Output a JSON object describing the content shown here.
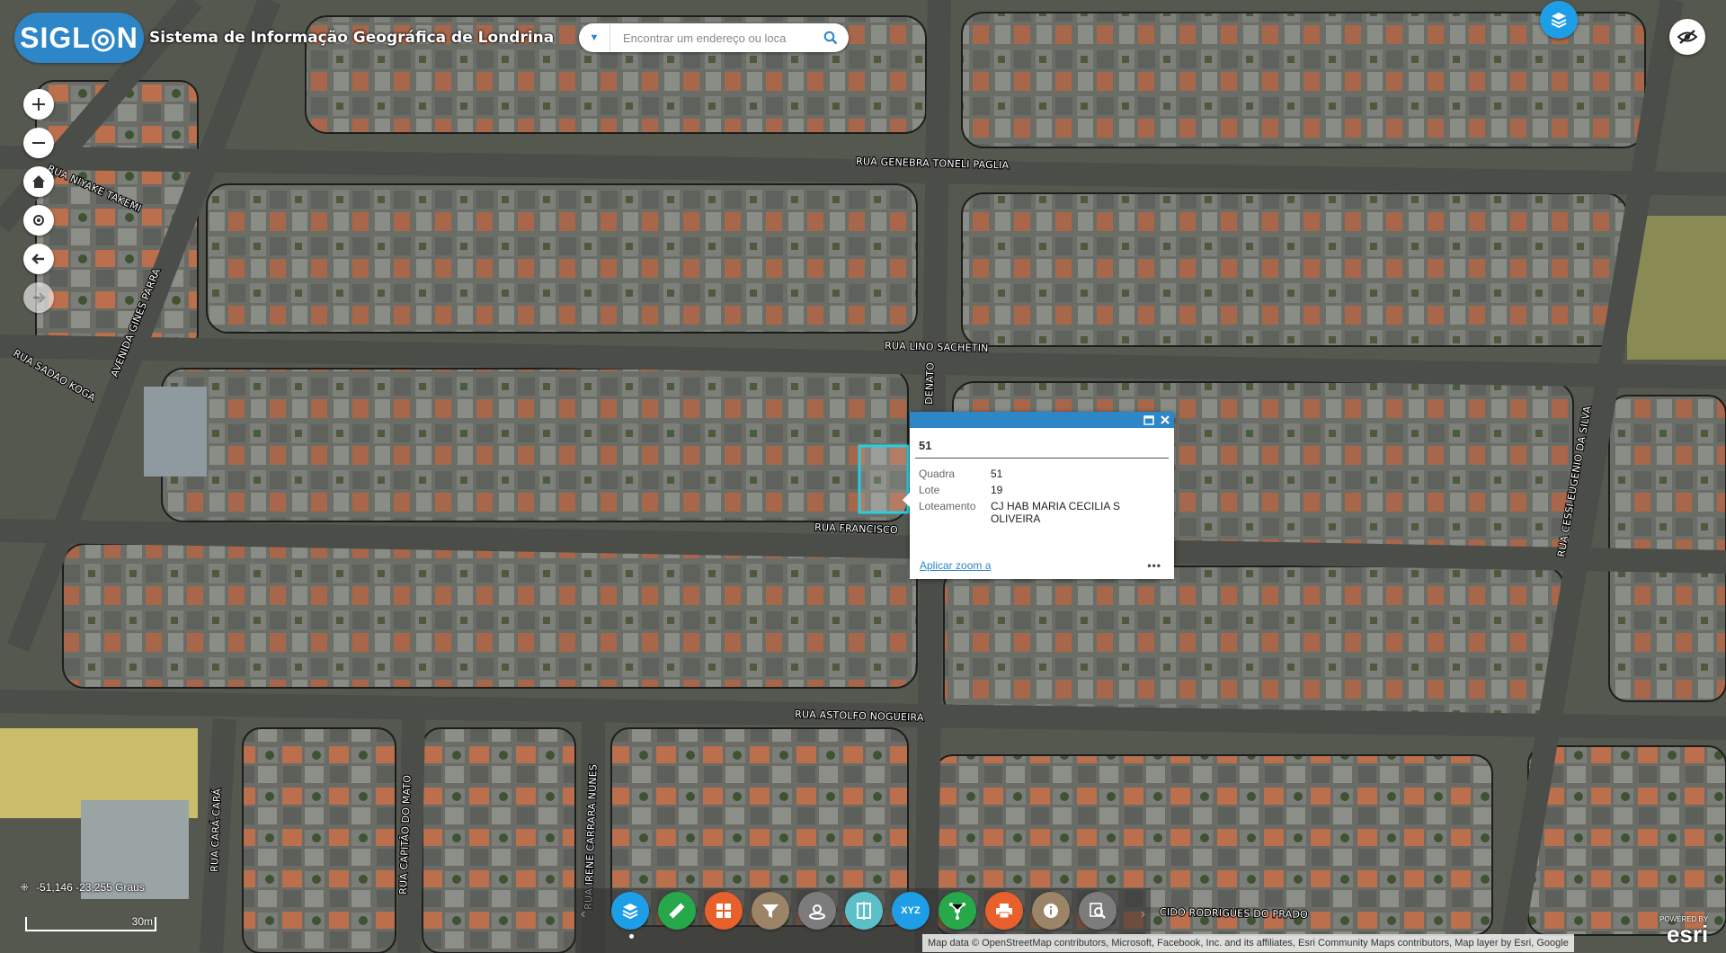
{
  "header": {
    "logo_text": "SIGL◎N",
    "title": "Sistema de Informação Geográfica de Londrina",
    "search_placeholder": "Encontrar um endereço ou loca"
  },
  "nav_icons": [
    "zoom-in-icon",
    "zoom-out-icon",
    "home-icon",
    "locate-icon",
    "back-icon",
    "forward-icon"
  ],
  "streets": [
    {
      "name": "RUA GENEBRA TONELI PAGLIA"
    },
    {
      "name": "RUA LINO SACHETIN"
    },
    {
      "name": "RUA FRANCISCO"
    },
    {
      "name": "RUA ASTOLFO NOGUEIRA"
    },
    {
      "name": "RUA NIYAKE TAKEMI"
    },
    {
      "name": "AVENIDA GINES PARRA"
    },
    {
      "name": "RUA SADAO KOGA"
    },
    {
      "name": "RUA CESSI EUGENIO DA SILVA"
    },
    {
      "name": "RUA CARÁ-CARÁ"
    },
    {
      "name": "RUA CAPITÃO DO MATO"
    },
    {
      "name": "RUA IRENE CARRARA NUNES"
    },
    {
      "name": "CIDO RODRIGUES DO PRADO"
    },
    {
      "name": "DENATO"
    }
  ],
  "popup": {
    "title": "51",
    "fields": [
      {
        "key": "Quadra",
        "value": "51"
      },
      {
        "key": "Lote",
        "value": "19"
      },
      {
        "key": "Loteamento",
        "value": "CJ HAB MARIA CECILIA S OLIVEIRA"
      }
    ],
    "zoom_link": "Aplicar zoom a",
    "more": "•••"
  },
  "coords": "-51,146 -23,255 Graus",
  "scale_label": "30m",
  "toolbar": [
    "layers-icon",
    "ruler-icon",
    "grid-icon",
    "filter-icon",
    "draw-icon",
    "swipe-icon",
    "xyz-icon",
    "network-icon",
    "print-icon",
    "info-icon",
    "search-map-icon"
  ],
  "attribution": "Map data © OpenStreetMap contributors, Microsoft, Facebook, Inc. and its affiliates, Esri Community Maps contributors, Map layer by Esri, Google",
  "esri": {
    "powered": "POWERED BY",
    "logo": "esri"
  },
  "colors": {
    "primary": "#2c86c8",
    "layers": "#1e9ee6",
    "highlight": "#27d0e0"
  }
}
